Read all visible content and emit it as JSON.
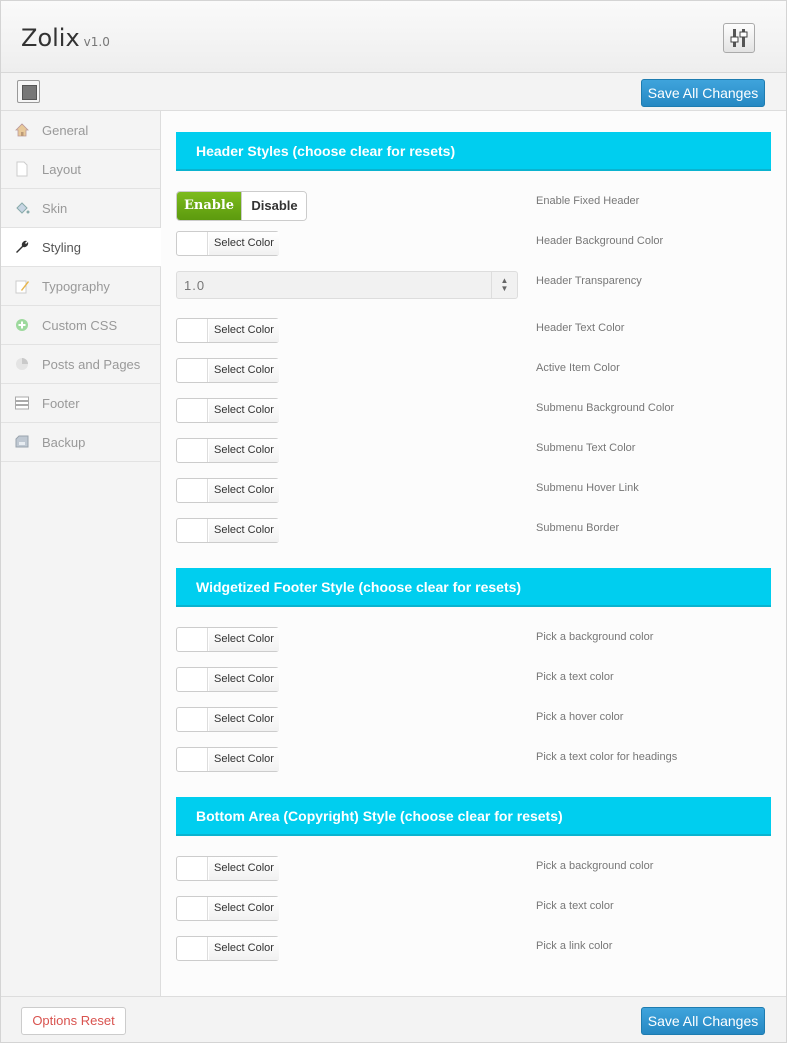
{
  "app": {
    "name": "Zolix",
    "version": "v1.0"
  },
  "toolbar": {
    "save_label": "Save All Changes"
  },
  "footer": {
    "reset_label": "Options Reset",
    "save_label": "Save All Changes"
  },
  "sidebar": {
    "items": [
      {
        "label": "General",
        "icon": "home-icon",
        "active": false
      },
      {
        "label": "Layout",
        "icon": "page-icon",
        "active": false
      },
      {
        "label": "Skin",
        "icon": "paint-bucket-icon",
        "active": false
      },
      {
        "label": "Styling",
        "icon": "wrench-icon",
        "active": true
      },
      {
        "label": "Typography",
        "icon": "pencil-icon",
        "active": false
      },
      {
        "label": "Custom CSS",
        "icon": "plus-circle-icon",
        "active": false
      },
      {
        "label": "Posts and Pages",
        "icon": "pie-chart-icon",
        "active": false
      },
      {
        "label": "Footer",
        "icon": "footer-layout-icon",
        "active": false
      },
      {
        "label": "Backup",
        "icon": "drive-icon",
        "active": false
      }
    ]
  },
  "sections": {
    "header": {
      "title": "Header Styles (choose clear for resets)",
      "toggle": {
        "enable": "Enable",
        "disable": "Disable",
        "label": "Enable Fixed Header",
        "selected": "Enable"
      },
      "bg_color": {
        "button": "Select Color",
        "label": "Header Background Color"
      },
      "transparency": {
        "value": "1.0",
        "label": "Header Transparency"
      },
      "fields": [
        {
          "button": "Select Color",
          "label": "Header Text Color"
        },
        {
          "button": "Select Color",
          "label": "Active Item Color"
        },
        {
          "button": "Select Color",
          "label": "Submenu Background Color"
        },
        {
          "button": "Select Color",
          "label": "Submenu Text Color"
        },
        {
          "button": "Select Color",
          "label": "Submenu Hover Link"
        },
        {
          "button": "Select Color",
          "label": "Submenu Border"
        }
      ]
    },
    "footer_widget": {
      "title": "Widgetized Footer Style (choose clear for resets)",
      "fields": [
        {
          "button": "Select Color",
          "label": "Pick a background color"
        },
        {
          "button": "Select Color",
          "label": "Pick a text color"
        },
        {
          "button": "Select Color",
          "label": "Pick a hover color"
        },
        {
          "button": "Select Color",
          "label": "Pick a text color for headings"
        }
      ]
    },
    "bottom": {
      "title": "Bottom Area (Copyright) Style (choose clear for resets)",
      "fields": [
        {
          "button": "Select Color",
          "label": "Pick a background color"
        },
        {
          "button": "Select Color",
          "label": "Pick a text color"
        },
        {
          "button": "Select Color",
          "label": "Pick a link color"
        }
      ]
    }
  },
  "colors": {
    "accent": "#00ceef",
    "primary": "#2a8fcb",
    "enable": "#6aa815",
    "reset": "#d9534f"
  }
}
